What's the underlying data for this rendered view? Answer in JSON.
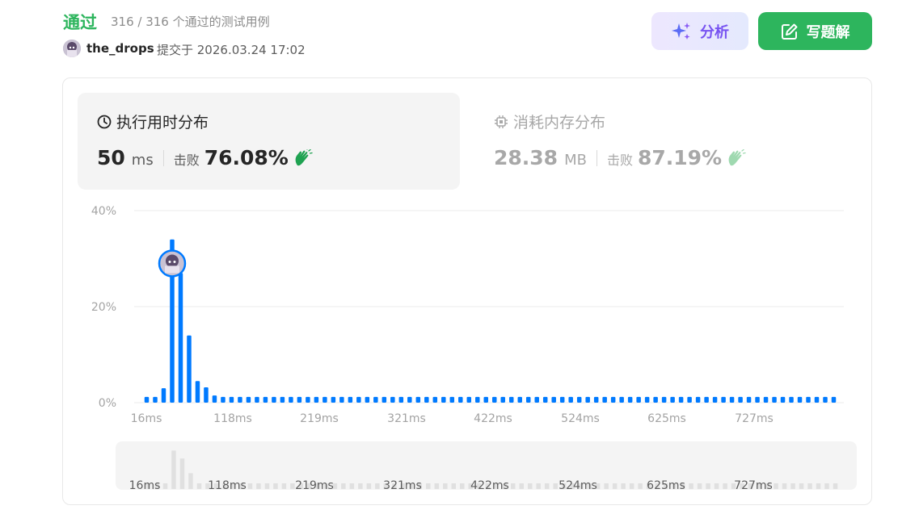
{
  "header": {
    "status": "通过",
    "detail": "316 / 316 个通过的测试用例",
    "username": "the_drops",
    "submit_time": "提交于 2026.03.24 17:02"
  },
  "buttons": {
    "analyze": "分析",
    "write_solution": "写题解"
  },
  "runtime": {
    "title": "执行用时分布",
    "value": "50",
    "unit": "ms",
    "beat_label": "击败",
    "beat_value": "76.08%"
  },
  "memory": {
    "title": "消耗内存分布",
    "value": "28.38",
    "unit": "MB",
    "beat_label": "击败",
    "beat_value": "87.19%"
  },
  "colors": {
    "accent_green": "#2db55d",
    "bar_blue": "#007aff",
    "analyze_purple": "#7752f1",
    "mini_bar": "#e0e0e0"
  },
  "chart_data": {
    "type": "bar",
    "ylim": [
      0,
      40
    ],
    "y_ticks": [
      "0%",
      "20%",
      "40%"
    ],
    "y_tick_values": [
      0,
      20,
      40
    ],
    "x_ticks": [
      "16ms",
      "118ms",
      "219ms",
      "321ms",
      "422ms",
      "524ms",
      "625ms",
      "727ms"
    ],
    "values": [
      1.2,
      1.2,
      3.0,
      34.0,
      27.0,
      14.0,
      4.5,
      3.2,
      1.5,
      1.2,
      1.2,
      1.2,
      1.2,
      1.2,
      1.2,
      1.2,
      1.2,
      1.2,
      1.2,
      1.2,
      1.2,
      1.2,
      1.2,
      1.2,
      1.2,
      1.2,
      1.2,
      1.2,
      1.2,
      1.2,
      1.2,
      1.2,
      1.2,
      1.2,
      1.2,
      1.2,
      1.2,
      1.2,
      1.2,
      1.2,
      1.2,
      1.2,
      1.2,
      1.2,
      1.2,
      1.2,
      1.2,
      1.2,
      1.2,
      1.2,
      1.2,
      1.2,
      1.2,
      1.2,
      1.2,
      1.2,
      1.2,
      1.2,
      1.2,
      1.2,
      1.2,
      1.2,
      1.2,
      1.2,
      1.2,
      1.2,
      1.2,
      1.2,
      1.2,
      1.2,
      1.2,
      1.2,
      1.2,
      1.2,
      1.2,
      1.2,
      1.2,
      1.2,
      1.2,
      1.2,
      1.2,
      1.2
    ],
    "marker_index": 3,
    "marker_value": 29,
    "grid": true
  }
}
